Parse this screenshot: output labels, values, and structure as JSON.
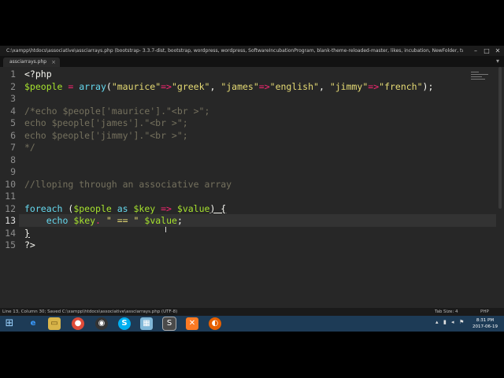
{
  "window": {
    "title": "C:\\xampp\\htdocs\\associative\\assciarrays.php (bootstrap- 3.3.7-dist, bootstrap, wordpress, wordpress, SoftwareIncubationProgram, blank-theme-reloaded-master, likes, incubation, NewFolder, twentyfifteen, trytheme, slider, slider) - Sublime Text"
  },
  "tabs": [
    {
      "label": "assciarrays.php"
    }
  ],
  "editor": {
    "line_numbers": [
      "1",
      "2",
      "3",
      "4",
      "5",
      "6",
      "7",
      "8",
      "9",
      "10",
      "11",
      "12",
      "13",
      "14",
      "15"
    ],
    "current_line": 13,
    "code": {
      "l1": "<?php",
      "l2": {
        "var": "$people",
        "eq": " = ",
        "fn": "array",
        "open": "(",
        "s1": "\"maurice\"",
        "a1": "=>",
        "s2": "\"greek\"",
        "c1": ", ",
        "s3": "\"james\"",
        "a2": "=>",
        "s4": "\"english\"",
        "c2": ", ",
        "s5": "\"jimmy\"",
        "a3": "=>",
        "s6": "\"french\"",
        "close": ");"
      },
      "l4": "/*echo $people['maurice'].\"<br >\";",
      "l5": "echo $people['james'].\"<br >\";",
      "l6": "echo $people['jimmy'].\"<br >\";",
      "l7": "*/",
      "l10": "//lloping through an associative array",
      "l12": {
        "kw": "foreach",
        "open": " (",
        "var1": "$people",
        "as": " as ",
        "var2": "$key",
        "arrow": " => ",
        "var3": "$value",
        "close": ") {"
      },
      "l13": {
        "indent": "    ",
        "kw": "echo",
        "sp": " ",
        "var1": "$key",
        "dot": ". ",
        "str": "\" == \"",
        "sp2": " ",
        "var2": "$value",
        "semi": ";"
      },
      "l14": "}",
      "l15": "?>"
    }
  },
  "status_bar": {
    "left": "Line 13, Column 30; Saved C:\\xampp\\htdocs\\associative\\assciarrays.php (UTF-8)",
    "tab_size": "Tab Size: 4",
    "syntax": "PHP"
  },
  "taskbar": {
    "time": "8:31 PM",
    "date": "2017-06-19"
  },
  "colors": {
    "editor_bg": "#272727",
    "keyword": "#66d9ef",
    "variable": "#a6e22e",
    "string": "#e6db74",
    "operator": "#f92672",
    "comment": "#75715e",
    "taskbar": "#1d3b56"
  }
}
